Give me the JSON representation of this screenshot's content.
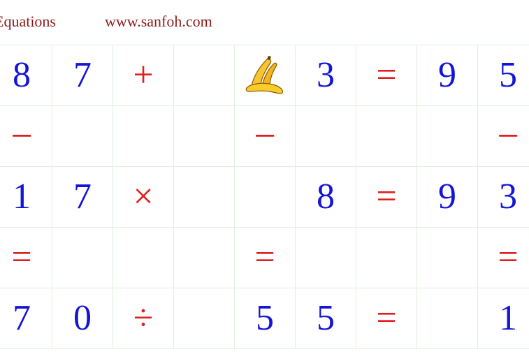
{
  "header": {
    "title": "Equations",
    "site": "www.sanfoh.com"
  },
  "puzzle": {
    "rows": [
      [
        {
          "t": "num",
          "v": "8"
        },
        {
          "t": "num",
          "v": "7"
        },
        {
          "t": "op",
          "v": "+"
        },
        {
          "t": "empty",
          "v": ""
        },
        {
          "t": "icon",
          "v": "banana"
        },
        {
          "t": "num",
          "v": "3"
        },
        {
          "t": "op",
          "v": "="
        },
        {
          "t": "num",
          "v": "9"
        },
        {
          "t": "num",
          "v": "5"
        }
      ],
      [
        {
          "t": "op",
          "v": "−"
        },
        {
          "t": "empty",
          "v": ""
        },
        {
          "t": "empty",
          "v": ""
        },
        {
          "t": "empty",
          "v": ""
        },
        {
          "t": "op",
          "v": "−"
        },
        {
          "t": "empty",
          "v": ""
        },
        {
          "t": "empty",
          "v": ""
        },
        {
          "t": "empty",
          "v": ""
        },
        {
          "t": "op",
          "v": "−"
        }
      ],
      [
        {
          "t": "num",
          "v": "1"
        },
        {
          "t": "num",
          "v": "7"
        },
        {
          "t": "op",
          "v": "×"
        },
        {
          "t": "empty",
          "v": ""
        },
        {
          "t": "empty",
          "v": ""
        },
        {
          "t": "num",
          "v": "8"
        },
        {
          "t": "op",
          "v": "="
        },
        {
          "t": "num",
          "v": "9"
        },
        {
          "t": "num",
          "v": "3"
        }
      ],
      [
        {
          "t": "op",
          "v": "="
        },
        {
          "t": "empty",
          "v": ""
        },
        {
          "t": "empty",
          "v": ""
        },
        {
          "t": "empty",
          "v": ""
        },
        {
          "t": "op",
          "v": "="
        },
        {
          "t": "empty",
          "v": ""
        },
        {
          "t": "empty",
          "v": ""
        },
        {
          "t": "empty",
          "v": ""
        },
        {
          "t": "op",
          "v": "="
        }
      ],
      [
        {
          "t": "num",
          "v": "7"
        },
        {
          "t": "num",
          "v": "0"
        },
        {
          "t": "op",
          "v": "÷"
        },
        {
          "t": "empty",
          "v": ""
        },
        {
          "t": "num",
          "v": "5"
        },
        {
          "t": "num",
          "v": "5"
        },
        {
          "t": "op",
          "v": "="
        },
        {
          "t": "empty",
          "v": ""
        },
        {
          "t": "num",
          "v": "1"
        }
      ]
    ]
  },
  "colors": {
    "number": "#1515d8",
    "operator": "#e01e1e",
    "header": "#8b1a1a",
    "grid_line": "#dff0df"
  }
}
